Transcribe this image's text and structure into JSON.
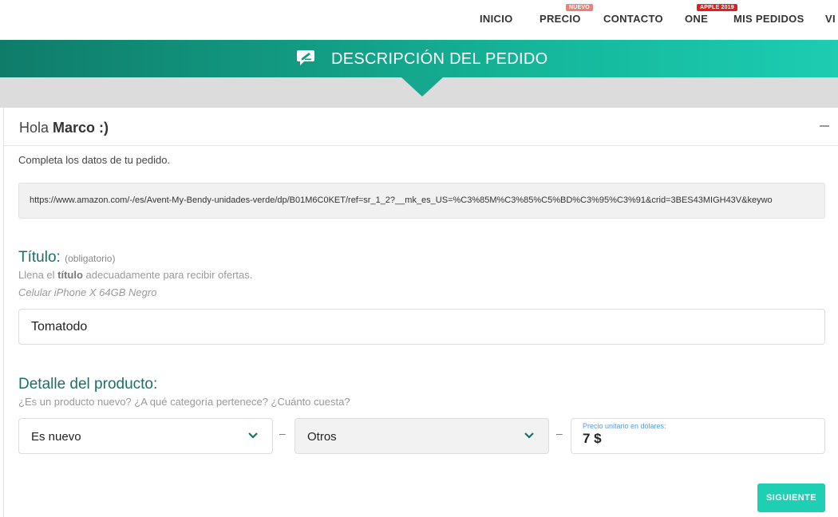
{
  "nav": {
    "items": [
      {
        "label": "INICIO"
      },
      {
        "label": "PRECIO",
        "badge": "NUEVO"
      },
      {
        "label": "CONTACTO"
      },
      {
        "label": "ONE",
        "badge": "APPLE 2019"
      },
      {
        "label": "MIS PEDIDOS"
      },
      {
        "label": "VI"
      }
    ]
  },
  "banner": {
    "title": "DESCRIPCIÓN DEL PEDIDO"
  },
  "card": {
    "greeting_prefix": "Hola ",
    "user_name": "Marco :)",
    "intro": "Completa los datos de tu pedido.",
    "url": "https://www.amazon.com/-/es/Avent-My-Bendy-unidades-verde/dp/B01M6C0KET/ref=sr_1_2?__mk_es_US=%C3%85M%C3%85%C5%BD%C3%95%C3%91&crid=3BES43MIGH43V&keywo"
  },
  "title_section": {
    "heading": "Título:",
    "required": "(obligatorio)",
    "helper_pre": "Llena el ",
    "helper_bold": "título",
    "helper_post": " adecuadamente para recibir ofertas.",
    "example": "Celular iPhone X 64GB Negro",
    "value": "Tomatodo"
  },
  "detail_section": {
    "heading": "Detalle del producto:",
    "helper": "¿Es un producto nuevo? ¿A qué categoría pertenece? ¿Cuánto cuesta?",
    "condition": "Es nuevo",
    "category": "Otros",
    "separator": "–",
    "price_label": "Precio unitario en dólares:",
    "price_value": "7 $"
  },
  "actions": {
    "next_label": "SIGUIENTE"
  },
  "colors": {
    "accent": "#1fcfb4",
    "heading": "#1c6f66",
    "badge_nuevo": "#e8837a",
    "badge_apple": "#e02020"
  }
}
